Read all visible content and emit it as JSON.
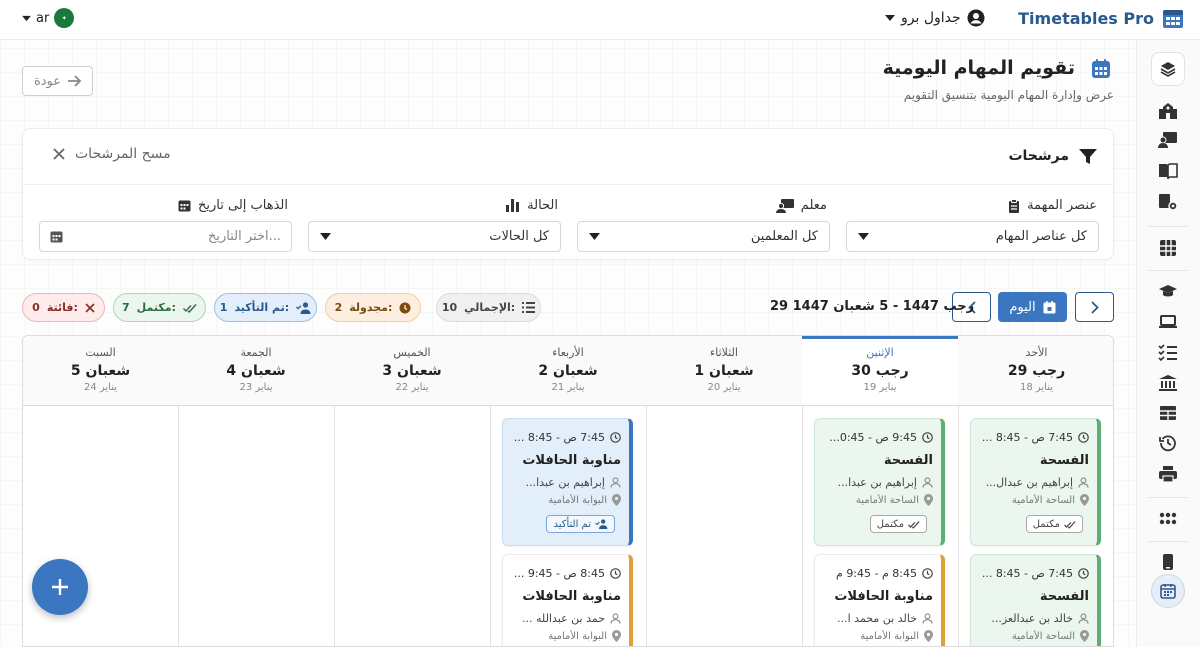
{
  "app": {
    "name": "Timetables Pro"
  },
  "user": {
    "name": "جداول برو"
  },
  "language": {
    "code": "ar"
  },
  "header": {
    "title": "تقويم المهام اليومية",
    "subtitle": "عرض وإدارة المهام اليومية بتنسيق التقويم",
    "back_label": "عودة"
  },
  "filters": {
    "title": "مرشحات",
    "clear_label": "مسح المرشحات",
    "task_element": {
      "label": "عنصر المهمة",
      "value": "كل عناصر المهام"
    },
    "teacher": {
      "label": "معلم",
      "value": "كل المعلمين"
    },
    "status": {
      "label": "الحالة",
      "value": "كل الحالات"
    },
    "go_to_date": {
      "label": "الذهاب إلى تاريخ",
      "placeholder": "اختر التاريخ..."
    }
  },
  "navigation": {
    "today_label": "اليوم",
    "range": "29 رجب 1447 - 5 شعبان 1447"
  },
  "summary": {
    "total": {
      "label": "الإجمالي:",
      "count": "10"
    },
    "scheduled": {
      "label": "مجدولة:",
      "count": "2"
    },
    "confirmed": {
      "label": "تم التأكيد:",
      "count": "1"
    },
    "completed": {
      "label": "مكتمل:",
      "count": "7"
    },
    "missed": {
      "label": "فائتة:",
      "count": "0"
    }
  },
  "days": [
    {
      "name": "الأحد",
      "hijri": "29 رجب",
      "greg": "18 يناير"
    },
    {
      "name": "الإثنين",
      "hijri": "30 رجب",
      "greg": "19 يناير",
      "active": true
    },
    {
      "name": "الثلاثاء",
      "hijri": "1 شعبان",
      "greg": "20 يناير"
    },
    {
      "name": "الأربعاء",
      "hijri": "2 شعبان",
      "greg": "21 يناير"
    },
    {
      "name": "الخميس",
      "hijri": "3 شعبان",
      "greg": "22 يناير"
    },
    {
      "name": "الجمعة",
      "hijri": "4 شعبان",
      "greg": "23 يناير"
    },
    {
      "name": "السبت",
      "hijri": "5 شعبان",
      "greg": "24 يناير"
    }
  ],
  "events": {
    "sun_1": {
      "time": "7:45 ص - 8:45 ...",
      "title": "الفسحة",
      "person": "إبراهيم بن عبدال...",
      "place": "الساحة الأمامية",
      "status": "مكتمل"
    },
    "sun_2": {
      "time": "7:45 ص - 8:45 ...",
      "title": "الفسحة",
      "person": "خالد بن عبدالعز...",
      "place": "الساحة الأمامية"
    },
    "mon_1": {
      "time": "9:45 ص - 0:45...",
      "title": "الفسحة",
      "person": "إبراهيم بن عبدا...",
      "place": "الساحة الأمامية",
      "status": "مكتمل"
    },
    "mon_2": {
      "time": "8:45 م - 9:45 م",
      "title": "مناوبة الحافلات",
      "person": "خالد بن محمد ا...",
      "place": "البوابة الأمامية"
    },
    "wed_1": {
      "time": "7:45 ص - 8:45 ...",
      "title": "مناوبة الحافلات",
      "person": "إبراهيم بن عبدا...",
      "place": "البوابة الأمامية",
      "status": "تم التأكيد"
    },
    "wed_2": {
      "time": "8:45 ص - 9:45 ...",
      "title": "مناوبة الحافلات",
      "person": "حمد بن عبدالله ...",
      "place": "البوابة الأمامية"
    }
  },
  "colors": {
    "primary": "#3b76c0",
    "brand": "#2a5a8c",
    "completed": "#5cae74",
    "confirmed": "#3b76c0",
    "scheduled": "#e0a13a",
    "missed": "#d9534f"
  }
}
